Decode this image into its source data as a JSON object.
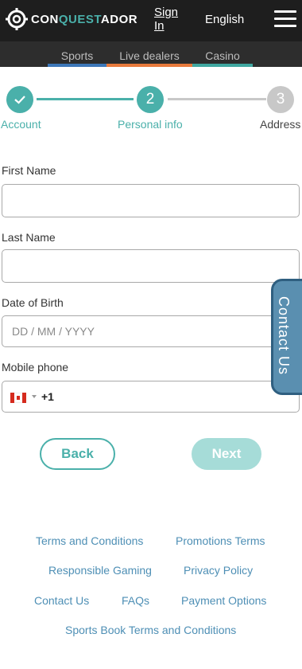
{
  "header": {
    "logo_text_a": "CON",
    "logo_text_b": "QUEST",
    "logo_text_c": "ADOR",
    "signin_label": "Sign In",
    "language_label": "English",
    "menu_icon": "hamburger-menu-icon"
  },
  "nav": {
    "items": [
      {
        "label": "Sports",
        "color": "#3d77b8"
      },
      {
        "label": "Live dealers",
        "color": "#e87a3c"
      },
      {
        "label": "Casino",
        "color": "#3fa7a0"
      }
    ]
  },
  "stepper": {
    "steps": [
      {
        "number": "",
        "label": "Account",
        "status": "done",
        "icon": "checkmark-icon"
      },
      {
        "number": "2",
        "label": "Personal info",
        "status": "active"
      },
      {
        "number": "3",
        "label": "Address",
        "status": "pending"
      }
    ],
    "accent_color": "#4ab0aa",
    "inactive_color": "#c8c8c8"
  },
  "form": {
    "first_name_label": "First Name",
    "first_name_value": "",
    "last_name_label": "Last Name",
    "last_name_value": "",
    "dob_label": "Date of Birth",
    "dob_placeholder": "DD / MM / YYYY",
    "phone_label": "Mobile phone",
    "phone_country": "Canada",
    "phone_dial_code": "+1"
  },
  "contact_tab": {
    "label": "Contact Us"
  },
  "buttons": {
    "back_label": "Back",
    "next_label": "Next"
  },
  "footer": {
    "links": [
      "Terms and Conditions",
      "Promotions Terms",
      "Responsible Gaming",
      "Privacy Policy",
      "Contact Us",
      "FAQs",
      "Payment Options",
      "Sports Book Terms and Conditions"
    ]
  }
}
